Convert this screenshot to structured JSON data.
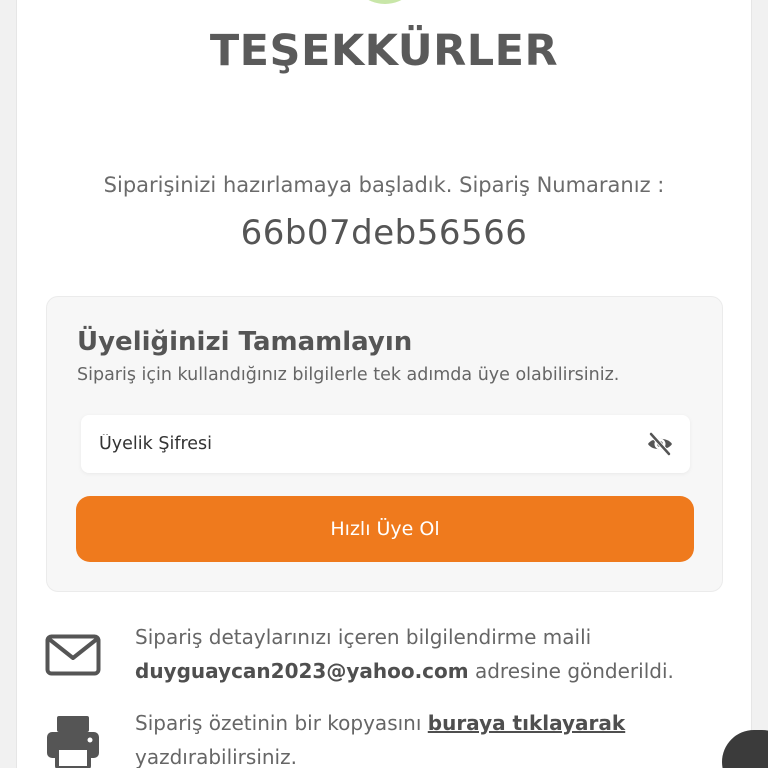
{
  "header": {
    "title": "TEŞEKKÜRLER"
  },
  "order": {
    "message": "Siparişinizi hazırlamaya başladık. Sipariş Numaranız :",
    "number": "66b07deb56566"
  },
  "membership": {
    "title": "Üyeliğinizi Tamamlayın",
    "subtitle": "Sipariş için kullandığınız bilgilerle tek adımda üye olabilirsiniz.",
    "password_placeholder": "Üyelik Şifresi",
    "button_label": "Hızlı Üye Ol"
  },
  "mail_info": {
    "icon": "envelope-icon",
    "line1": "Sipariş detaylarınızı içeren bilgilendirme maili",
    "email": "duyguaycan2023@yahoo.com",
    "line2_suffix": "adresine gönderildi."
  },
  "print_info": {
    "icon": "printer-icon",
    "prefix": "Sipariş özetinin bir kopyasını",
    "link_text": "buraya tıklayarak",
    "suffix": "yazdırabilirsiniz."
  },
  "colors": {
    "accent": "#ef7a1d",
    "success": "#c8e6a8",
    "text": "#555555"
  }
}
